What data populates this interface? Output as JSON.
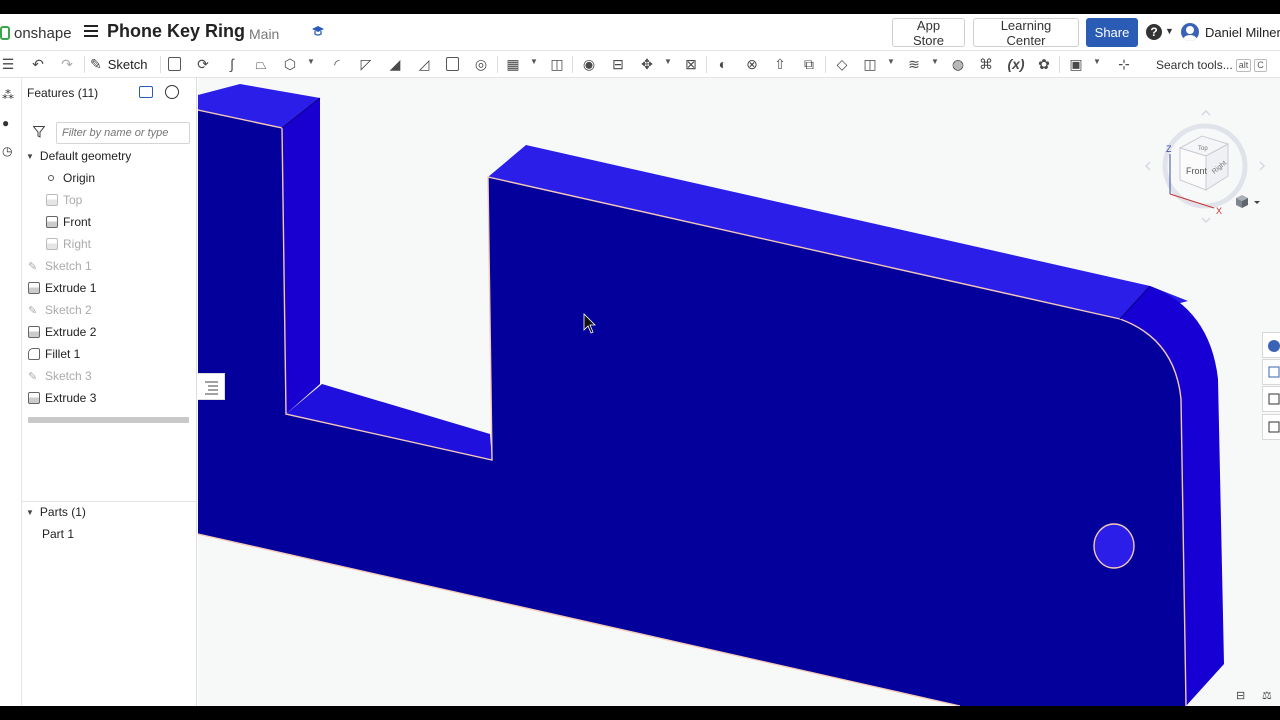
{
  "app": {
    "brand": "onshape",
    "document_title": "Phone Key Ring",
    "branch": "Main"
  },
  "header": {
    "app_store_label": "App Store",
    "learning_center_label": "Learning Center",
    "share_label": "Share",
    "help_label": "?",
    "user_name": "Daniel Milner"
  },
  "toolbar": {
    "sketch_label": "Sketch",
    "search_label": "Search tools...",
    "search_shortcut_1": "alt",
    "search_shortcut_2": "C"
  },
  "feature_panel": {
    "title": "Features (11)",
    "filter_placeholder": "Filter by name or type",
    "default_geometry_label": "Default geometry",
    "items": [
      {
        "label": "Origin",
        "kind": "origin",
        "dim": false
      },
      {
        "label": "Top",
        "kind": "plane",
        "dim": true
      },
      {
        "label": "Front",
        "kind": "plane",
        "dim": false
      },
      {
        "label": "Right",
        "kind": "plane",
        "dim": true
      },
      {
        "label": "Sketch 1",
        "kind": "sketch",
        "dim": true
      },
      {
        "label": "Extrude 1",
        "kind": "extrude",
        "dim": false
      },
      {
        "label": "Sketch 2",
        "kind": "sketch",
        "dim": true
      },
      {
        "label": "Extrude 2",
        "kind": "extrude",
        "dim": false
      },
      {
        "label": "Fillet 1",
        "kind": "fillet",
        "dim": false
      },
      {
        "label": "Sketch 3",
        "kind": "sketch",
        "dim": true
      },
      {
        "label": "Extrude 3",
        "kind": "extrude",
        "dim": false
      }
    ],
    "parts_label": "Parts (1)",
    "parts": [
      {
        "label": "Part 1"
      }
    ]
  },
  "view_cube": {
    "front_label": "Front",
    "top_label": "Top",
    "right_label": "Right",
    "axis_z": "Z",
    "axis_x": "X"
  },
  "colors": {
    "model_face": "#03009c",
    "model_top": "#2b1fe6",
    "model_side": "#1800d8",
    "edge_highlight": "#f4c9b9",
    "accent": "#2a5bb5"
  }
}
